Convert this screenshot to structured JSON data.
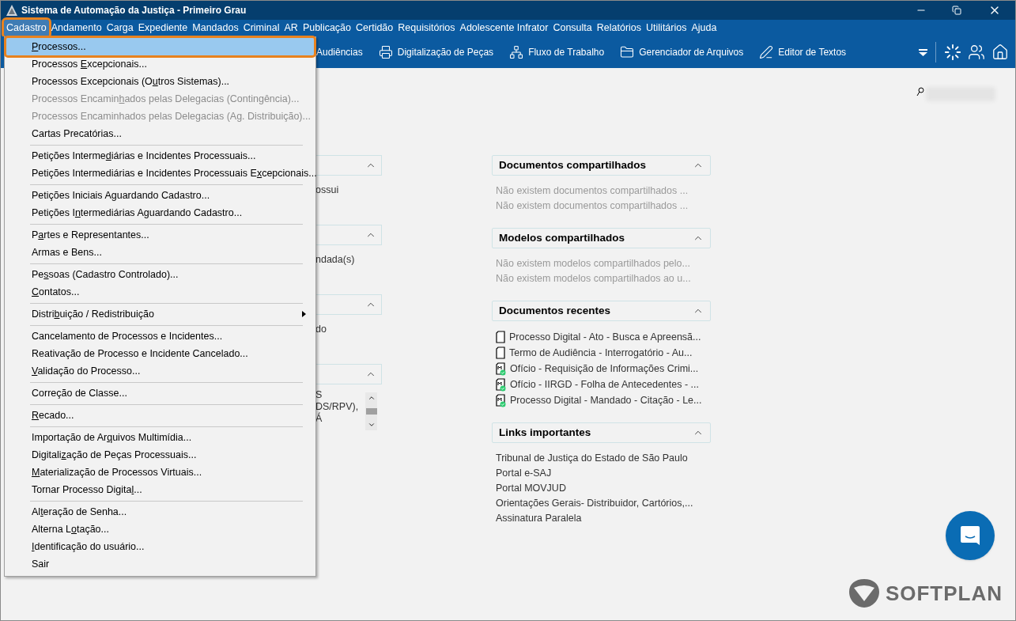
{
  "window": {
    "title": "Sistema de Automação da Justiça - Primeiro Grau"
  },
  "menu_bar": [
    {
      "label": "Cadastro",
      "selected": true
    },
    {
      "label": "Andamento",
      "selected": false
    },
    {
      "label": "Carga",
      "selected": false
    },
    {
      "label": "Expediente",
      "selected": false
    },
    {
      "label": "Mandados",
      "selected": false
    },
    {
      "label": "Criminal",
      "selected": false
    },
    {
      "label": "AR",
      "selected": false
    },
    {
      "label": "Publicação",
      "selected": false
    },
    {
      "label": "Certidão",
      "selected": false
    },
    {
      "label": "Requisitórios",
      "selected": false
    },
    {
      "label": "Adolescente Infrator",
      "selected": false
    },
    {
      "label": "Consulta",
      "selected": false
    },
    {
      "label": "Relatórios",
      "selected": false
    },
    {
      "label": "Utilitários",
      "selected": false
    },
    {
      "label": "Ajuda",
      "selected": false
    }
  ],
  "toolbar": [
    "Audiências",
    "Digitalização de Peças",
    "Fluxo de Trabalho",
    "Gerenciador de Arquivos",
    "Editor de Textos"
  ],
  "dropdown": [
    {
      "kind": "item",
      "key": "P",
      "after": "rocessos...",
      "selected": true,
      "disabled": false
    },
    {
      "kind": "item",
      "before": "Processos ",
      "key": "E",
      "after": "xcepcionais...",
      "selected": false,
      "disabled": false
    },
    {
      "kind": "item",
      "before": "Processos Excepcionais (O",
      "key": "u",
      "after": "tros Sistemas)...",
      "selected": false,
      "disabled": false
    },
    {
      "kind": "item",
      "before": "Processos Encamin",
      "key": "h",
      "after": "ados pelas Delegacias (Contingência)...",
      "selected": false,
      "disabled": true
    },
    {
      "kind": "item",
      "before": "Processos Encaminhados pelas Dele",
      "key": "g",
      "after": "acias (Ag. Distribuição)...",
      "selected": false,
      "disabled": true
    },
    {
      "kind": "item",
      "before": "Cartas Precatórias...",
      "selected": false,
      "disabled": false
    },
    {
      "kind": "separator"
    },
    {
      "kind": "item",
      "before": "Petições Interme",
      "key": "d",
      "after": "iárias e Incidentes Processuais...",
      "selected": false,
      "disabled": false
    },
    {
      "kind": "item",
      "before": "Petições Intermediárias e Incidentes Processuais E",
      "key": "x",
      "after": "cepcionais...",
      "selected": false,
      "disabled": false
    },
    {
      "kind": "separator"
    },
    {
      "kind": "item",
      "before": "Petições Iniciais Aguardando Cadastro...",
      "selected": false,
      "disabled": false
    },
    {
      "kind": "item",
      "before": "Petições I",
      "key": "n",
      "after": "termediárias Aguardando Cadastro...",
      "selected": false,
      "disabled": false
    },
    {
      "kind": "separator"
    },
    {
      "kind": "item",
      "before": "P",
      "key": "a",
      "after": "rtes e Representantes...",
      "selected": false,
      "disabled": false
    },
    {
      "kind": "item",
      "before": "Armas e Bens...",
      "selected": false,
      "disabled": false
    },
    {
      "kind": "separator"
    },
    {
      "kind": "item",
      "before": "Pe",
      "key": "s",
      "after": "soas (Cadastro Controlado)...",
      "selected": false,
      "disabled": false
    },
    {
      "kind": "item",
      "key": "C",
      "after": "ontatos...",
      "selected": false,
      "disabled": false
    },
    {
      "kind": "separator"
    },
    {
      "kind": "submenu",
      "before": "Distri",
      "key": "b",
      "after": "uição / Redistribuição",
      "selected": false,
      "disabled": false
    },
    {
      "kind": "separator"
    },
    {
      "kind": "item",
      "before": "Cancelamento de Processos e Incidentes...",
      "selected": false,
      "disabled": false
    },
    {
      "kind": "item",
      "before": "Reativação de Processo e Incidente Cancelado...",
      "selected": false,
      "disabled": false
    },
    {
      "kind": "item",
      "key": "V",
      "after": "alidação do Processo...",
      "selected": false,
      "disabled": false
    },
    {
      "kind": "separator"
    },
    {
      "kind": "item",
      "before": "Correção de Classe...",
      "selected": false,
      "disabled": false
    },
    {
      "kind": "separator"
    },
    {
      "kind": "item",
      "key": "R",
      "after": "ecado...",
      "selected": false,
      "disabled": false
    },
    {
      "kind": "separator"
    },
    {
      "kind": "item",
      "before": "Importação de Ar",
      "key": "q",
      "after": "uivos Multimídia...",
      "selected": false,
      "disabled": false
    },
    {
      "kind": "item",
      "before": "Digitali",
      "key": "z",
      "after": "ação de Peças Processuais...",
      "selected": false,
      "disabled": false
    },
    {
      "kind": "item",
      "key": "M",
      "after": "aterialização de Processos Virtuais...",
      "selected": false,
      "disabled": false
    },
    {
      "kind": "item",
      "before": "Tornar Processo Digita",
      "key": "l",
      "after": "...",
      "selected": false,
      "disabled": false
    },
    {
      "kind": "separator"
    },
    {
      "kind": "item",
      "before": "Al",
      "key": "t",
      "after": "eração de Senha...",
      "selected": false,
      "disabled": false
    },
    {
      "kind": "item",
      "before": "Alterna L",
      "key": "o",
      "after": "tação...",
      "selected": false,
      "disabled": false
    },
    {
      "kind": "item",
      "key": "I",
      "after": "dentificação do usuário...",
      "selected": false,
      "disabled": false
    },
    {
      "kind": "item",
      "before": "Sair",
      "selected": false,
      "disabled": false
    }
  ],
  "left_panels": [
    {
      "expanded": true,
      "lines": [
        "ossui"
      ]
    },
    {
      "expanded": true,
      "lines": [
        "ndada(s)"
      ]
    },
    {
      "expanded": true,
      "lines": [
        "do"
      ]
    },
    {
      "expanded": true,
      "scroll": true,
      "lines": [
        "S",
        "DS/RPV),",
        "Á"
      ]
    }
  ],
  "right_panels": [
    {
      "title": "Documentos compartilhados",
      "expanded": true,
      "kind": "empty",
      "lines": [
        "Não existem documentos compartilhados ...",
        "Não existem documentos compartilhados ..."
      ]
    },
    {
      "title": "Modelos compartilhados",
      "expanded": true,
      "kind": "empty",
      "lines": [
        "Não existem modelos compartilhados pelo...",
        "Não existem modelos compartilhados ao u..."
      ]
    },
    {
      "title": "Documentos recentes",
      "expanded": true,
      "kind": "recent",
      "items": [
        {
          "text": "Processo Digital - Ato - Busca e Apreensã...",
          "kind": "page"
        },
        {
          "text": "Termo de Audiência - Interrogatório - Au...",
          "kind": "page"
        },
        {
          "text": "Ofício - Requisição de Informações Crimi...",
          "kind": "signed"
        },
        {
          "text": "Ofício - IIRGD - Folha de Antecedentes - ...",
          "kind": "signed"
        },
        {
          "text": "Processo Digital - Mandado - Citação - Le...",
          "kind": "signed"
        }
      ]
    },
    {
      "title": "Links importantes",
      "expanded": true,
      "kind": "links",
      "lines": [
        "Tribunal de Justiça do Estado de São Paulo",
        "Portal e-SAJ",
        "Portal MOVJUD",
        "Orientações Gerais- Distribuidor, Cartórios,...",
        "Assinatura Paralela"
      ]
    }
  ],
  "brand": {
    "logo_text": "SOFTPLAN"
  }
}
